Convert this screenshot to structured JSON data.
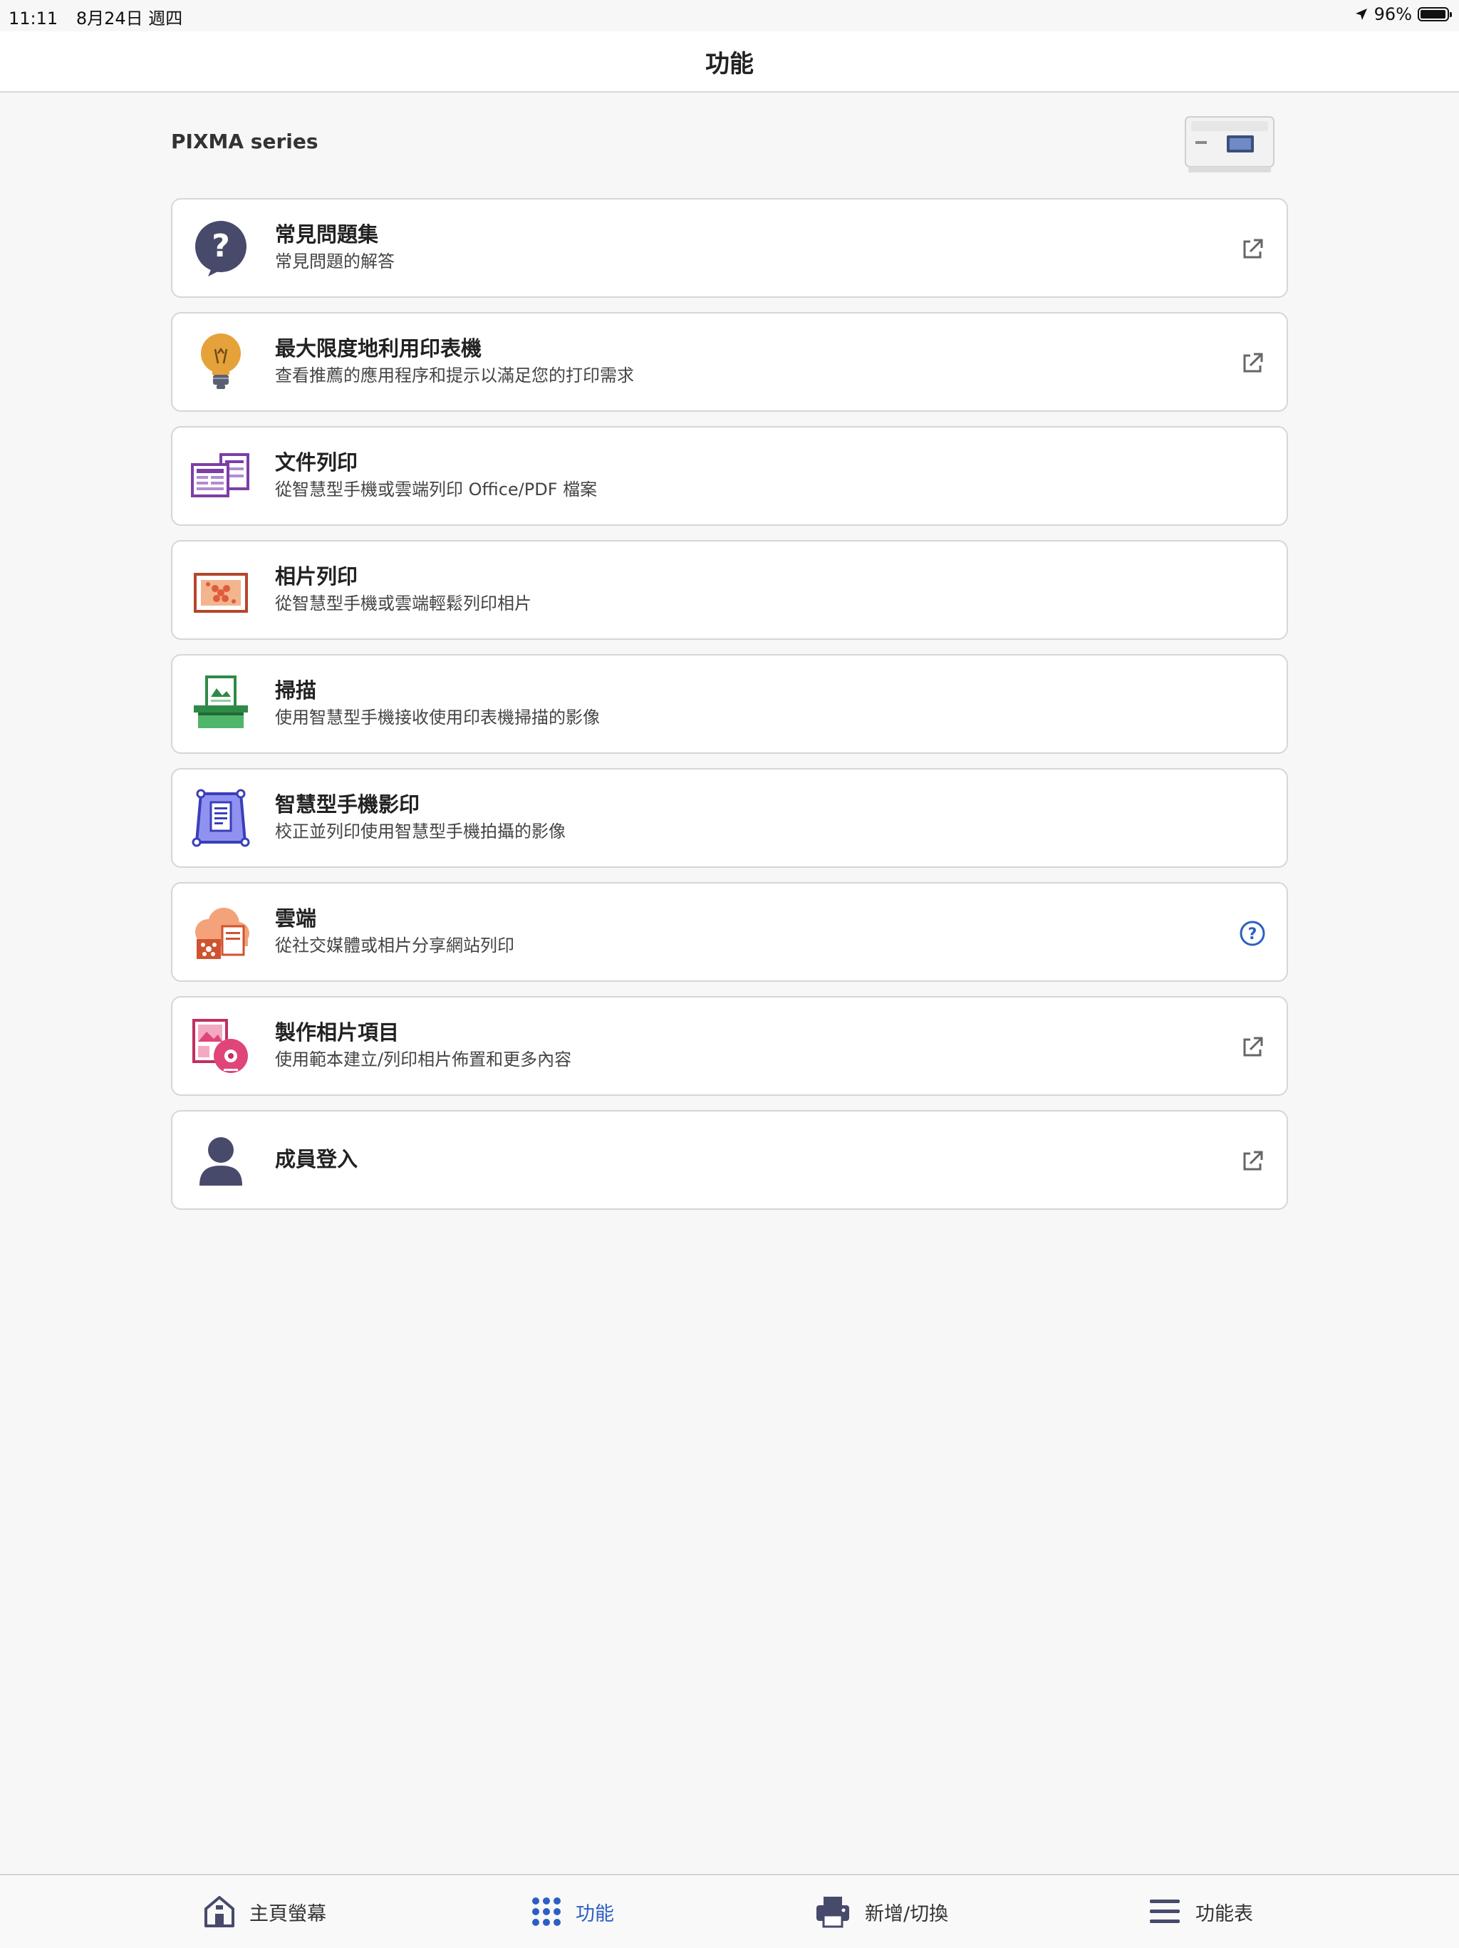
{
  "status_bar": {
    "time": "11:11",
    "date": "8月24日 週四",
    "battery": "96%",
    "battery_level": 0.96
  },
  "nav": {
    "title": "功能"
  },
  "printer": {
    "name": "PIXMA series"
  },
  "items": [
    {
      "title": "常見問題集",
      "subtitle": "常見問題的解答",
      "icon": "faq-icon",
      "trailing": "external-link-icon"
    },
    {
      "title": "最大限度地利用印表機",
      "subtitle": "查看推薦的應用程序和提示以滿足您的打印需求",
      "icon": "lightbulb-icon",
      "trailing": "external-link-icon"
    },
    {
      "title": "文件列印",
      "subtitle": "從智慧型手機或雲端列印 Office/PDF 檔案",
      "icon": "document-print-icon",
      "trailing": ""
    },
    {
      "title": "相片列印",
      "subtitle": "從智慧型手機或雲端輕鬆列印相片",
      "icon": "photo-print-icon",
      "trailing": ""
    },
    {
      "title": "掃描",
      "subtitle": "使用智慧型手機接收使用印表機掃描的影像",
      "icon": "scan-icon",
      "trailing": ""
    },
    {
      "title": "智慧型手機影印",
      "subtitle": "校正並列印使用智慧型手機拍攝的影像",
      "icon": "smartphone-copy-icon",
      "trailing": ""
    },
    {
      "title": "雲端",
      "subtitle": "從社交媒體或相片分享網站列印",
      "icon": "cloud-icon",
      "trailing": "help-icon"
    },
    {
      "title": "製作相片項目",
      "subtitle": "使用範本建立/列印相片佈置和更多內容",
      "icon": "photo-project-icon",
      "trailing": "external-link-icon"
    },
    {
      "title": "成員登入",
      "subtitle": "",
      "icon": "member-icon",
      "trailing": "external-link-icon"
    }
  ],
  "tabs": [
    {
      "label": "主頁螢幕",
      "icon": "home-icon",
      "active": false
    },
    {
      "label": "功能",
      "icon": "grid-dots-icon",
      "active": true
    },
    {
      "label": "新增/切換",
      "icon": "printer-icon",
      "active": false
    },
    {
      "label": "功能表",
      "icon": "menu-icon",
      "active": false
    }
  ],
  "colors": {
    "accent": "#2c5fc4",
    "icon_dark": "#474a6b",
    "lightbulb": "#e5a23a",
    "document": "#7b3fa6",
    "photo": "#b5462b",
    "scan": "#2f8a47",
    "smartphone_copy": "#5b5fd6",
    "cloud": "#e9865a",
    "photo_project": "#e0457a"
  }
}
